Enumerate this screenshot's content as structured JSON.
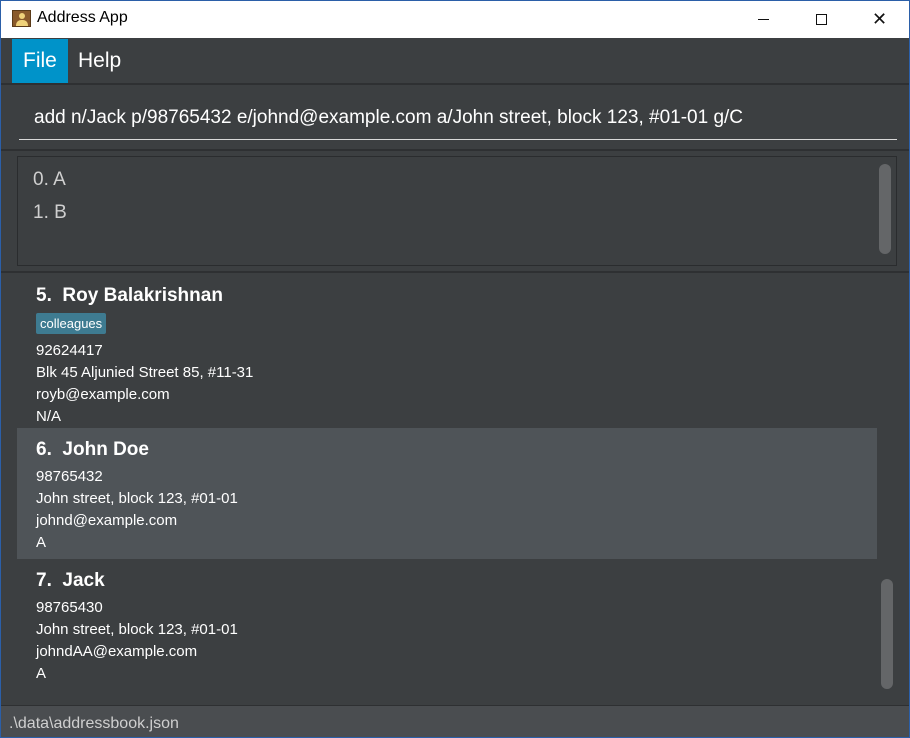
{
  "window": {
    "title": "Address App"
  },
  "window_controls": {
    "minimize": "minimize",
    "maximize": "maximize",
    "close": "✕"
  },
  "menu": {
    "items": [
      {
        "label": "File"
      },
      {
        "label": "Help"
      }
    ]
  },
  "command": {
    "value": "add n/Jack p/98765432 e/johnd@example.com a/John street, block 123, #01-01 g/C"
  },
  "result": {
    "lines": [
      "0. A",
      "1. B"
    ]
  },
  "persons": [
    {
      "index": "5.",
      "name": "Roy Balakrishnan",
      "tags": [
        "colleagues"
      ],
      "phone": "92624417",
      "address": "Blk 45 Aljunied Street 85, #11-31",
      "email": "royb@example.com",
      "group": "N/A"
    },
    {
      "index": "6.",
      "name": "John Doe",
      "tags": [],
      "phone": "98765432",
      "address": "John street, block 123, #01-01",
      "email": "johnd@example.com",
      "group": "A"
    },
    {
      "index": "7.",
      "name": "Jack",
      "tags": [],
      "phone": "98765430",
      "address": "John street, block 123, #01-01",
      "email": "johndAA@example.com",
      "group": "A"
    }
  ],
  "status": {
    "path": ".\\data\\addressbook.json"
  },
  "icons": {
    "app": "address-book-icon"
  },
  "colors": {
    "menu_active": "#0093c9",
    "tag": "#3e7b91",
    "selected_row": "#4f5458",
    "background": "#3c3f41"
  }
}
